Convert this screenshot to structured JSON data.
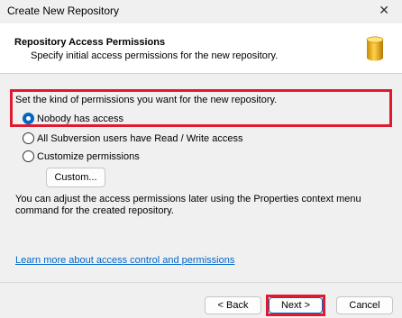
{
  "window": {
    "title": "Create New Repository",
    "close_glyph": "✕"
  },
  "header": {
    "title": "Repository Access Permissions",
    "subtitle": "Specify initial access permissions for the new repository.",
    "icon": "database-icon"
  },
  "permissions": {
    "prompt": "Set the kind of permissions you want for the new repository.",
    "options": [
      {
        "label": "Nobody has access",
        "checked": true
      },
      {
        "label": "All Subversion users have Read / Write access",
        "checked": false
      },
      {
        "label": "Customize permissions",
        "checked": false
      }
    ],
    "custom_button": "Custom..."
  },
  "info_text": "You can adjust the access permissions later using the Properties context menu command for the created repository.",
  "learn_more_link": "Learn more about access control and permissions",
  "footer": {
    "back_label": "< Back",
    "next_label": "Next >",
    "cancel_label": "Cancel"
  },
  "colors": {
    "highlight": "#e0192f",
    "link": "#0066cc",
    "radio_accent": "#0067c0"
  }
}
